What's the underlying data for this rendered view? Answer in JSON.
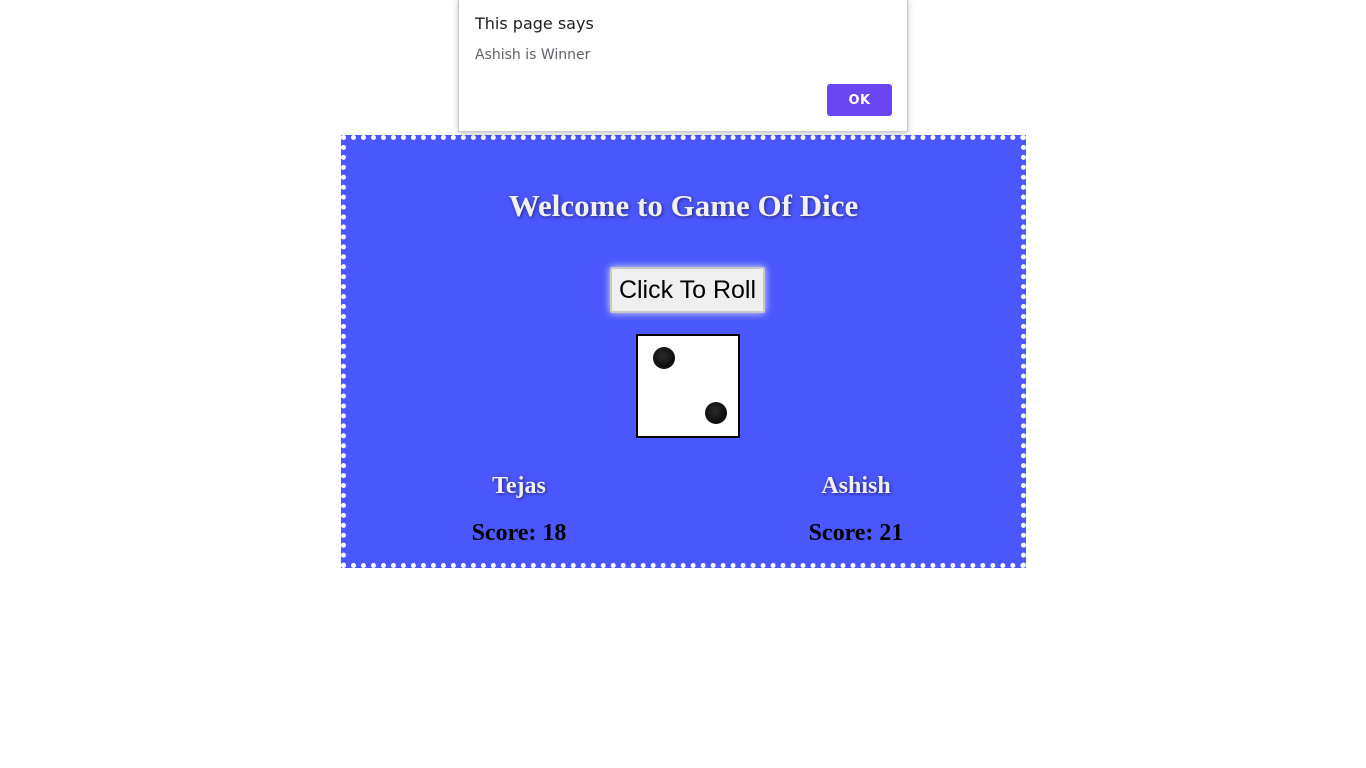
{
  "game": {
    "title": "Welcome to Game Of Dice",
    "roll_button_label": "Click To Roll",
    "die_value": 2,
    "players": [
      {
        "name": "Tejas",
        "score_text": "Score: 18",
        "score": 18
      },
      {
        "name": "Ashish",
        "score_text": "Score: 21",
        "score": 21
      }
    ],
    "colors": {
      "background": "#4a57fd",
      "border": "#ffffff",
      "heading_text": "#f1f1f1",
      "score_text": "#000000"
    }
  },
  "alert": {
    "title": "This page says",
    "message": "Ashish is Winner",
    "ok_label": "OK",
    "ok_color": "#6a46f0"
  }
}
